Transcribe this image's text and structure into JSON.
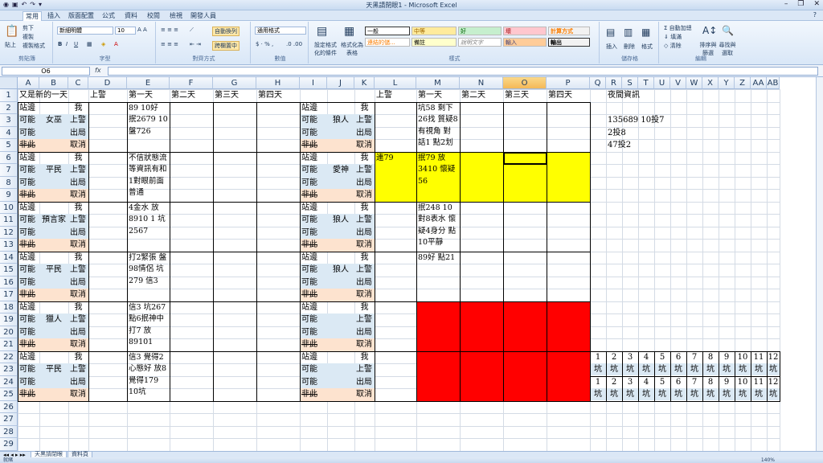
{
  "window": {
    "title": "天黑請閉眼1 - Microsoft Excel"
  },
  "tabs": [
    "常用",
    "插入",
    "版面配置",
    "公式",
    "資料",
    "校閱",
    "檢視",
    "開發人員"
  ],
  "ribbon": {
    "clipboard": {
      "paste": "貼上",
      "cut": "剪下",
      "copy": "複製",
      "format_painter": "複製格式",
      "group": "剪貼簿"
    },
    "font": {
      "name": "新細明體",
      "size": "10",
      "group": "字型"
    },
    "alignment": {
      "wrap": "自動換列",
      "merge": "跨欄置中",
      "group": "對齊方式"
    },
    "number": {
      "format": "通用格式",
      "group": "數值"
    },
    "styles": {
      "cond": "設定格式化的條件",
      "table": "格式化為表格",
      "group": "樣式",
      "cells": [
        "一般",
        "中等",
        "好",
        "壞",
        "計算方式",
        "連結的儲...",
        "備註",
        "說明文字",
        "輸入",
        "輸出"
      ]
    },
    "cells_group": {
      "insert": "插入",
      "delete": "刪除",
      "format": "格式",
      "group": "儲存格"
    },
    "editing": {
      "autosum": "自動加總",
      "fill": "填滿",
      "clear": "清除",
      "sort": "排序與篩選",
      "find": "尋找與選取",
      "group": "編輯"
    }
  },
  "formula_bar": {
    "name_box": "O6",
    "fx": "fx",
    "value": ""
  },
  "columns": [
    "A",
    "B",
    "C",
    "D",
    "E",
    "F",
    "G",
    "H",
    "I",
    "J",
    "K",
    "L",
    "M",
    "N",
    "O",
    "P",
    "Q",
    "R",
    "S",
    "T",
    "U",
    "V",
    "W",
    "X",
    "Y",
    "Z",
    "AA",
    "AB"
  ],
  "rows": [
    "1",
    "2",
    "3",
    "4",
    "5",
    "6",
    "7",
    "8",
    "9",
    "10",
    "11",
    "12",
    "13",
    "14",
    "15",
    "16",
    "17",
    "18",
    "19",
    "20",
    "21",
    "22",
    "23",
    "24",
    "25",
    "26",
    "27",
    "28",
    "29"
  ],
  "header_row": {
    "A1": "又是新的一天",
    "D1": "上警",
    "E1": "第一天",
    "F1": "第二天",
    "G1": "第三天",
    "H1": "第四天",
    "L1": "上警",
    "M1": "第一天",
    "N1": "第二天",
    "O1": "第三天",
    "P1": "第四天",
    "R1": "夜間資訊"
  },
  "labels": {
    "side": "站邊",
    "maybe": "可能",
    "not": "非此",
    "me": "我",
    "police": "上警",
    "out": "出局",
    "cancel": "取消"
  },
  "left_roles": [
    "女巫",
    "平民",
    "預言家",
    "平民",
    "獵人",
    "平民"
  ],
  "right_roles": [
    "狼人",
    "愛神",
    "狼人",
    "狼人",
    "",
    ""
  ],
  "left_notes": [
    "89 10好 抿2679 10 盤726",
    "不信狀態流 等資訊有和1對眼前面普通",
    "4金水 放8910 1 坑2567",
    "打2緊張 盤98情侶 坑279 信3",
    "信3 坑267點6抿神中打7 放89101",
    "信3 覺得2心態好 放8覺得179 10坑"
  ],
  "right_notes": {
    "M2": "坑58 剩下26找 質疑8有視角 對話1 點2划",
    "L6": "連79",
    "M6": "抿79 放3410 懷疑56",
    "M10": "抿248 10 對8表水 懷疑4身分 點10平靜",
    "M14": "89好 點21"
  },
  "night_info": [
    "135689 10投7",
    "2投8",
    "47投2"
  ],
  "pit_numbers": [
    "1",
    "2",
    "3",
    "4",
    "5",
    "6",
    "7",
    "8",
    "9",
    "10",
    "11",
    "12"
  ],
  "pit_label": "坑",
  "sheets": [
    "天黑請閉眼",
    "資料頁"
  ],
  "status": {
    "ready": "就緒",
    "zoom": "140%"
  },
  "colors": {
    "yellow": "#ffff00",
    "red": "#ff0000",
    "blue_fill": "#dbe9f4",
    "peach_fill": "#fde3cf"
  }
}
